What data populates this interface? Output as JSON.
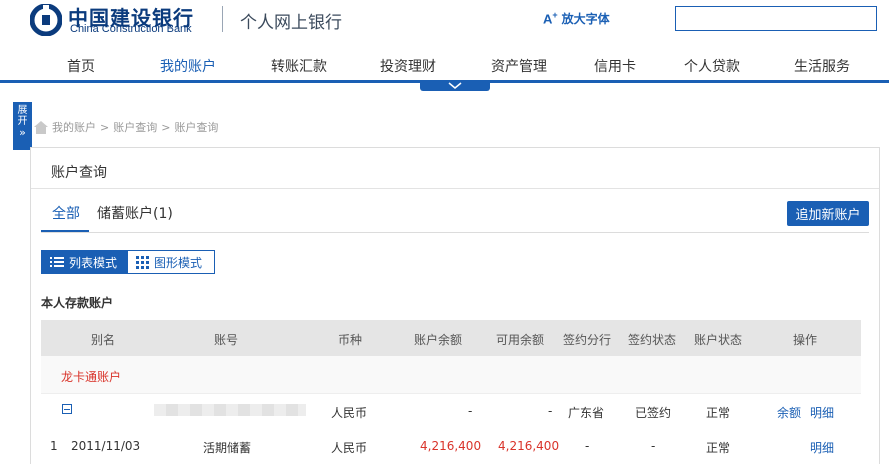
{
  "header": {
    "bank_name_cn": "中国建设银行",
    "bank_name_en": "China Construction Bank",
    "site_title": "个人网上银行",
    "zoom_icon": "A",
    "zoom_label": "放大字体",
    "search_value": ""
  },
  "nav": {
    "items": [
      {
        "label": "首页"
      },
      {
        "label": "我的账户",
        "active": true
      },
      {
        "label": "转账汇款"
      },
      {
        "label": "投资理财"
      },
      {
        "label": "资产管理"
      },
      {
        "label": "信用卡"
      },
      {
        "label": "个人贷款"
      },
      {
        "label": "生活服务"
      }
    ]
  },
  "side_tab": {
    "line1": "展",
    "line2": "开",
    "chevron": "»"
  },
  "breadcrumb": {
    "items": [
      "我的账户",
      "账户查询",
      "账户查询"
    ],
    "separator": ">"
  },
  "panel": {
    "title": "账户查询",
    "tabs": [
      {
        "label": "全部"
      },
      {
        "label": "储蓄账户(1)"
      }
    ],
    "add_button": "追加新账户",
    "modes": {
      "list": "列表模式",
      "grid": "图形模式"
    },
    "section_title": "本人存款账户"
  },
  "table": {
    "headers": [
      "别名",
      "账号",
      "币种",
      "账户余额",
      "可用余额",
      "签约分行",
      "签约状态",
      "账户状态",
      "操作"
    ],
    "group_label": "龙卡通账户",
    "rows": [
      {
        "index": "",
        "alias": "",
        "account": "",
        "currency": "人民币",
        "balance": "-",
        "available": "-",
        "branch": "广东省",
        "sign_status": "已签约",
        "acct_status": "正常",
        "op1": "余额",
        "op2": "明细"
      },
      {
        "index": "1",
        "alias": "2011/11/03",
        "account": "活期储蓄",
        "currency": "人民币",
        "balance": "4,216,400",
        "available": "4,216,400",
        "branch": "-",
        "sign_status": "-",
        "acct_status": "正常",
        "op1": "",
        "op2": "明细"
      }
    ]
  },
  "colors": {
    "brand": "#1a5fb4",
    "alert": "#d9342b"
  }
}
